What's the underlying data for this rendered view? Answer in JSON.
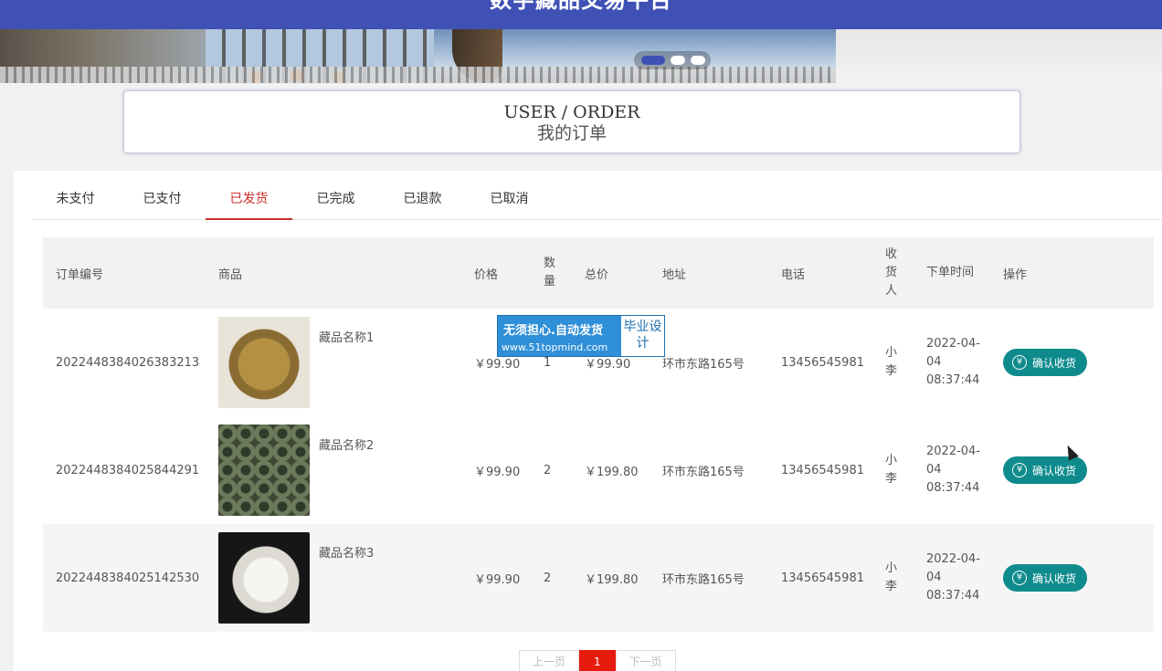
{
  "header": {
    "site_title": "数字藏品交易平台"
  },
  "banner": {
    "slides": 3,
    "active_slide": 1
  },
  "heading": {
    "en": "USER / ORDER",
    "zh": "我的订单"
  },
  "tabs": [
    {
      "label": "未支付"
    },
    {
      "label": "已支付"
    },
    {
      "label": "已发货",
      "active": true
    },
    {
      "label": "已完成"
    },
    {
      "label": "已退款"
    },
    {
      "label": "已取消"
    }
  ],
  "table": {
    "headers": {
      "order_id": "订单编号",
      "goods": "商品",
      "price": "价格",
      "qty": "数量",
      "total": "总价",
      "address": "地址",
      "phone": "电话",
      "receiver": "收货人",
      "time": "下单时间",
      "action": "操作"
    },
    "rows": [
      {
        "order_id": "2022448384026383213",
        "goods_name": "藏品名称1",
        "price": "￥99.90",
        "qty": "1",
        "total": "￥99.90",
        "address": "环市东路165号",
        "phone": "13456545981",
        "receiver": "小李",
        "time": "2022-04-04 08:37:44",
        "action": "确认收货"
      },
      {
        "order_id": "2022448384025844291",
        "goods_name": "藏品名称2",
        "price": "￥99.90",
        "qty": "2",
        "total": "￥199.80",
        "address": "环市东路165号",
        "phone": "13456545981",
        "receiver": "小李",
        "time": "2022-04-04 08:37:44",
        "action": "确认收货"
      },
      {
        "order_id": "2022448384025142530",
        "goods_name": "藏品名称3",
        "price": "￥99.90",
        "qty": "2",
        "total": "￥199.80",
        "address": "环市东路165号",
        "phone": "13456545981",
        "receiver": "小李",
        "time": "2022-04-04 08:37:44",
        "action": "确认收货"
      }
    ]
  },
  "watermark": {
    "line1": "无须担心.自动发货",
    "line2": "www.51topmind.com",
    "badge": "毕业设计"
  },
  "pager": {
    "prev": "上一页",
    "current": "1",
    "next": "下一页"
  },
  "icons": {
    "confirm": "yen-circle-icon"
  },
  "colors": {
    "header": "#3f51b5",
    "tab_active": "#c9302c",
    "confirm_button": "#0f8b8d",
    "pager_current": "#e61b0e"
  }
}
